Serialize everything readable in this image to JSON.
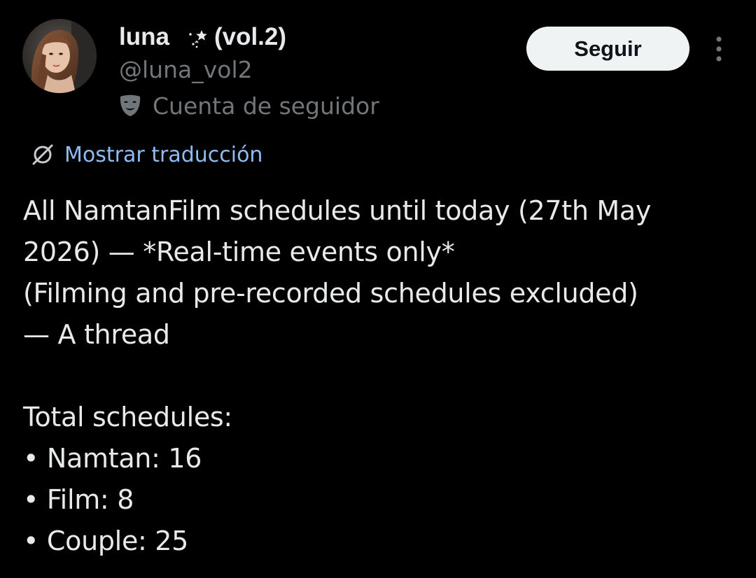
{
  "tweet": {
    "author": {
      "display_name": "luna",
      "display_name_suffix": "(vol.2)",
      "handle": "@luna_vol2",
      "account_label": "Cuenta de seguidor",
      "account_label_icon": "mask-icon",
      "avatar": "profile-photo"
    },
    "follow_label": "Seguir",
    "more_icon": "more-vertical-icon",
    "translate_label": "Mostrar traducción",
    "translate_icon": "translate-icon",
    "body_lines": [
      "All NamtanFilm schedules until today (27th May",
      "2026) — *Real-time events only*",
      "(Filming and pre-recorded schedules excluded)",
      "— A thread",
      "",
      "Total schedules:",
      "• Namtan: 16",
      "• Film: 8",
      "• Couple: 25"
    ]
  },
  "colors": {
    "background": "#000000",
    "primary_text": "#e7e9ea",
    "secondary_text": "#71767b",
    "link": "#8fbbf0",
    "button_bg": "#eff3f4",
    "button_text": "#0f1419"
  }
}
